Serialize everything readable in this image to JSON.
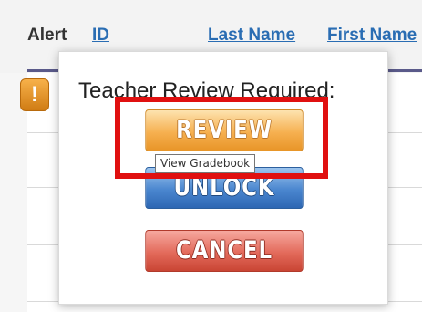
{
  "table": {
    "headers": {
      "alert": "Alert",
      "id": "ID",
      "last_name": "Last Name",
      "first_name": "First Name"
    },
    "first_row_icon": "exclamation-icon"
  },
  "popup": {
    "title": "Teacher Review Required:",
    "review_label": "REVIEW",
    "unlock_label": "UNLOCK",
    "cancel_label": "CANCEL",
    "tooltip": "View Gradebook"
  },
  "colors": {
    "link": "#2a6db3",
    "review": "#f6b050",
    "unlock": "#4a86cf",
    "cancel": "#e36a5b",
    "highlight": "#e01010"
  }
}
